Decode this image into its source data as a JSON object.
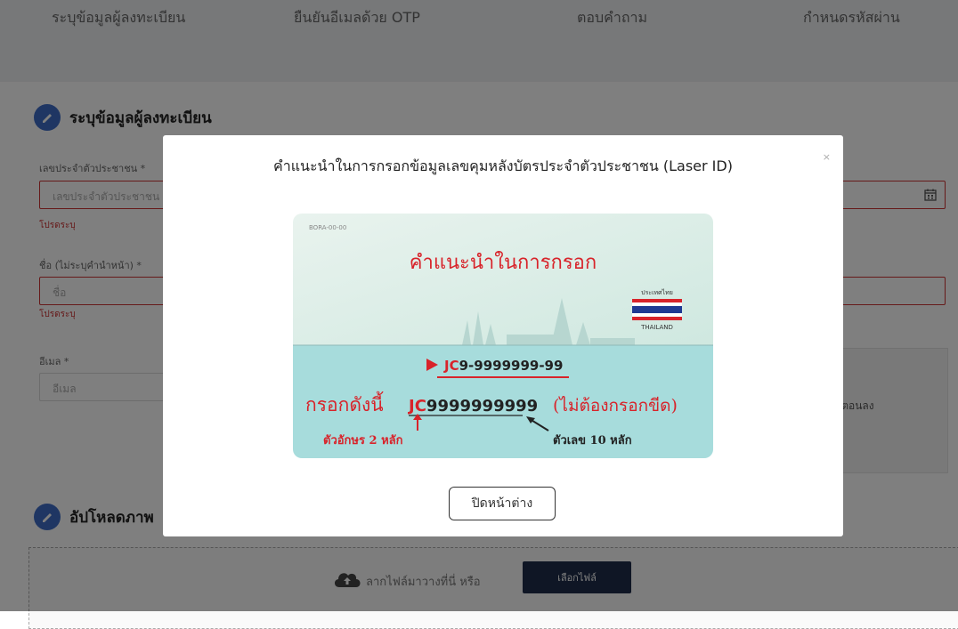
{
  "steps": [
    "ระบุข้อมูลผู้ลงทะเบียน",
    "ยืนยันอีเมลด้วย OTP",
    "ตอบคำถาม",
    "กำหนดรหัสผ่าน"
  ],
  "form": {
    "section_title": "ระบุข้อมูลผู้ลงทะเบียน",
    "id_label": "เลขประจำตัวประชาชน *",
    "id_placeholder": "เลขประจำตัวประชาชน",
    "id_error": "โปรดระบุ",
    "name_label": "ชื่อ (ไม่ระบุคำนำหน้า) *",
    "name_placeholder": "ชื่อ",
    "name_error": "โปรดระบุ",
    "email_label": "อีเมล *",
    "email_placeholder": "อีเมล",
    "consent_fragment": "นตอนลง"
  },
  "upload": {
    "section_title": "อัปโหลดภาพ",
    "hint": "ลากไฟล์มาวางที่นี่ หรือ",
    "select_button": "เลือกไฟล์"
  },
  "modal": {
    "title": "คำแนะนำในการกรอกข้อมูลเลขคุมหลังบัตรประจำตัวประชาชน (Laser ID)",
    "close": "×",
    "close_button": "ปิดหน้าต่าง",
    "card": {
      "code": "BORA-00-00",
      "heading": "คำแนะนำในการกรอก",
      "country_th": "ประเทศไทย",
      "country_en": "THAILAND",
      "laser_prefix": "JC",
      "laser_rest": "9-9999999-99",
      "fill_label": "กรอกดังนี้",
      "fill_prefix": "JC",
      "fill_rest": "9999999999",
      "no_dash": "(ไม่ต้องกรอกขีด)",
      "letters_note": "ตัวอักษร 2 หลัก",
      "digits_note": "ตัวเลข 10 หลัก"
    }
  },
  "colors": {
    "accent": "#3f6dc7",
    "error": "#cc3333",
    "card_red": "#d8232a",
    "card_top": "#dbeee5",
    "card_bottom": "#a7dcdc"
  }
}
